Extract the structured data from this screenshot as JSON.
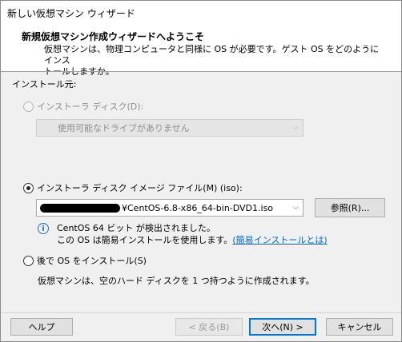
{
  "window": {
    "title": "新しい仮想マシン ウィザード"
  },
  "header": {
    "title": "新規仮想マシン作成ウィザードへようこそ",
    "desc_line1": "仮想マシンは、物理コンピュータと同様に OS が必要です。ゲスト OS をどのようにインス",
    "desc_line2": "トールしますか。"
  },
  "source_label": "インストール元:",
  "option_disc": {
    "label": "インストーラ ディスク(D):",
    "checked": false,
    "enabled": false,
    "combo_value": "使用可能なドライブがありません"
  },
  "option_iso": {
    "label": "インストーラ ディスク イメージ ファイル(M) (iso):",
    "checked": true,
    "path_suffix": "¥CentOS-6.8-x86_64-bin-DVD1.iso",
    "browse_label": "参照(R)..."
  },
  "detection": {
    "icon": "info-icon",
    "line1": "CentOS 64 ビット が検出されました。",
    "line2_prefix": "この OS は簡易インストールを使用します。",
    "link": "(簡易インストールとは)"
  },
  "option_later": {
    "label": "後で OS をインストール(S)",
    "checked": false,
    "desc": "仮想マシンは、空のハード ディスクを 1 つ持つように作成されます。"
  },
  "buttons": {
    "help": "ヘルプ",
    "back": "< 戻る(B)",
    "next": "次へ(N) >",
    "cancel": "キャンセル"
  },
  "colors": {
    "link": "#0066cc",
    "focus": "#0078d7"
  }
}
